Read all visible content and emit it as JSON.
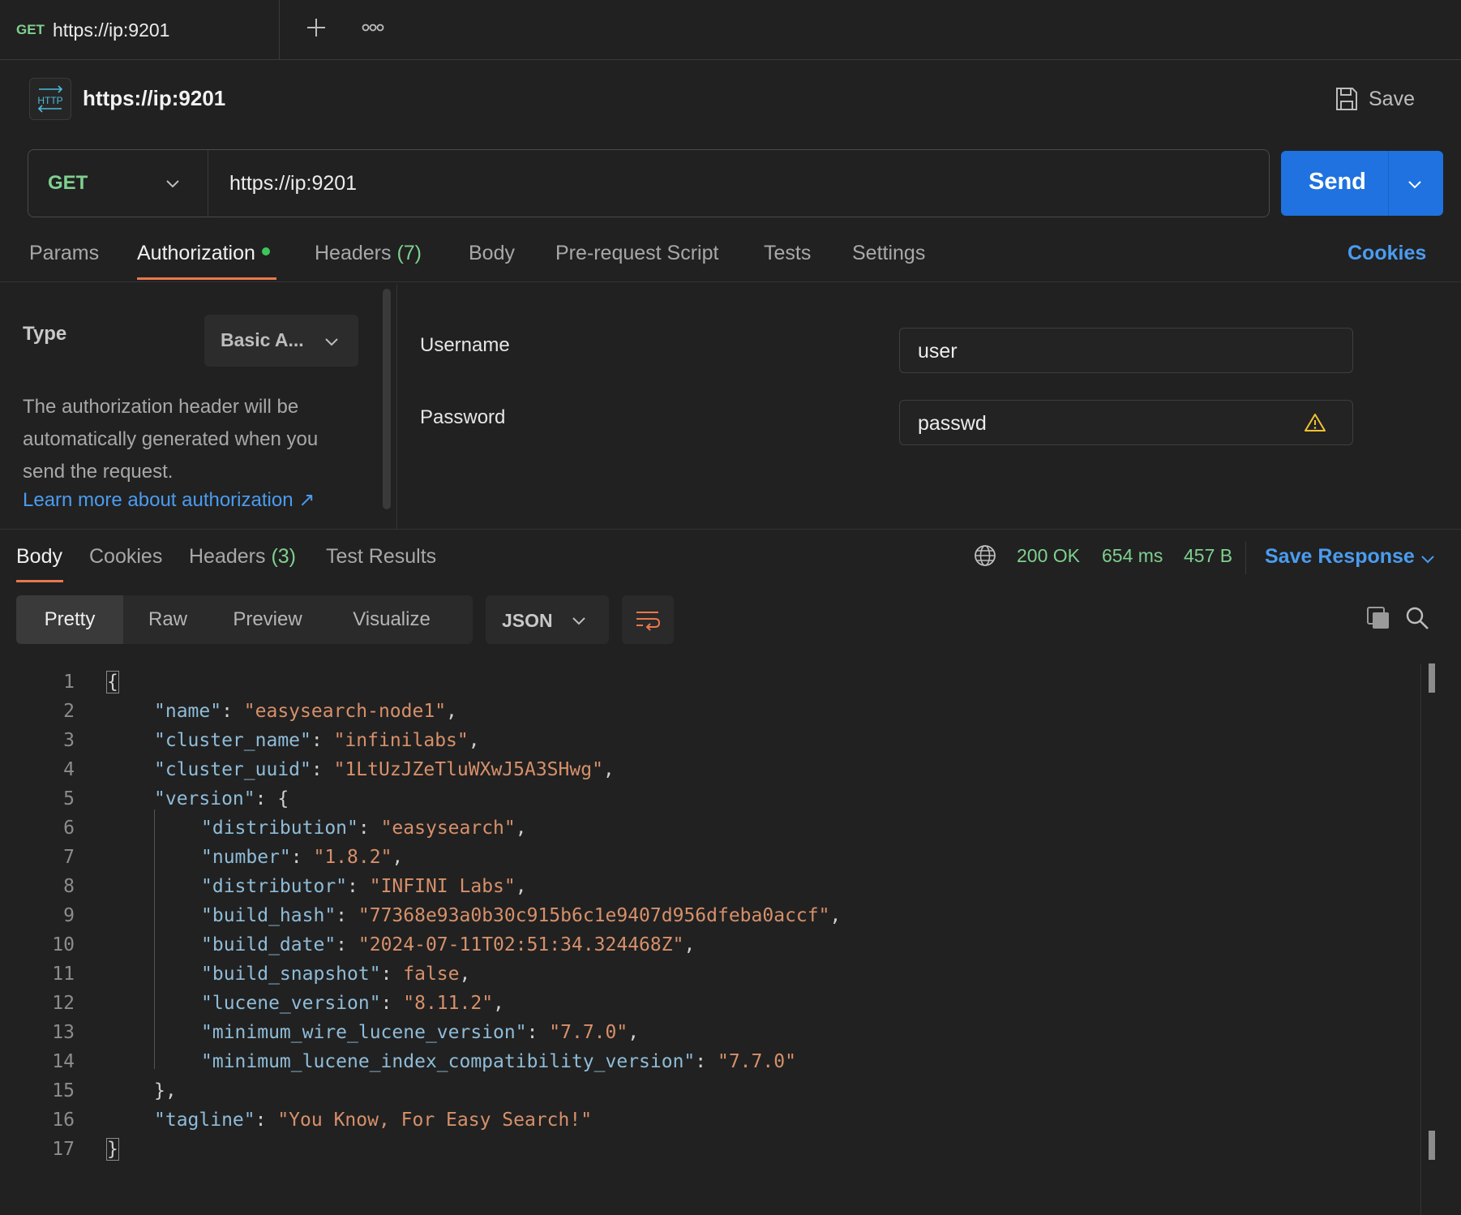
{
  "tab": {
    "method": "GET",
    "title": "https://ip:9201"
  },
  "request": {
    "badge": "HTTP",
    "title": "https://ip:9201",
    "save_label": "Save",
    "method": "GET",
    "url": "https://ip:9201",
    "send_label": "Send"
  },
  "req_tabs": {
    "params": "Params",
    "authorization": "Authorization",
    "headers": "Headers",
    "headers_count": "(7)",
    "body": "Body",
    "prerequest": "Pre-request Script",
    "tests": "Tests",
    "settings": "Settings",
    "cookies": "Cookies"
  },
  "auth": {
    "type_label": "Type",
    "type_value": "Basic A...",
    "description": "The authorization header will be automatically generated when you send the request.",
    "learn_more": "Learn more about authorization ↗",
    "username_label": "Username",
    "username_value": "user",
    "password_label": "Password",
    "password_value": "passwd"
  },
  "response": {
    "tabs": {
      "body": "Body",
      "cookies": "Cookies",
      "headers": "Headers",
      "headers_count": "(3)",
      "test_results": "Test Results"
    },
    "status": "200 OK",
    "time": "654 ms",
    "size": "457 B",
    "save_response": "Save Response",
    "views": [
      "Pretty",
      "Raw",
      "Preview",
      "Visualize"
    ],
    "format": "JSON"
  },
  "colors": {
    "accent_blue": "#1f72e0",
    "link_blue": "#4a9cf0",
    "method_green": "#7fd08f",
    "tab_underline": "#e8784c",
    "json_key": "#8fbcd8",
    "json_string": "#d7906a"
  },
  "icons": [
    "http-icon",
    "plus-icon",
    "more-icon",
    "save-icon",
    "chevron-down-icon",
    "warning-icon",
    "globe-icon",
    "wrap-icon",
    "copy-icon",
    "search-icon"
  ],
  "code_lines": [
    {
      "n": "1",
      "indent": 0,
      "key": "",
      "val": "",
      "raw": "{",
      "type": "open"
    },
    {
      "n": "2",
      "indent": 1,
      "key": "\"name\"",
      "val": "\"easysearch-node1\"",
      "tail": ","
    },
    {
      "n": "3",
      "indent": 1,
      "key": "\"cluster_name\"",
      "val": "\"infinilabs\"",
      "tail": ","
    },
    {
      "n": "4",
      "indent": 1,
      "key": "\"cluster_uuid\"",
      "val": "\"1LtUzJZeTluWXwJ5A3SHwg\"",
      "tail": ","
    },
    {
      "n": "5",
      "indent": 1,
      "key": "\"version\"",
      "val": "",
      "tail": "{",
      "type": "objopen"
    },
    {
      "n": "6",
      "indent": 2,
      "key": "\"distribution\"",
      "val": "\"easysearch\"",
      "tail": ","
    },
    {
      "n": "7",
      "indent": 2,
      "key": "\"number\"",
      "val": "\"1.8.2\"",
      "tail": ","
    },
    {
      "n": "8",
      "indent": 2,
      "key": "\"distributor\"",
      "val": "\"INFINI Labs\"",
      "tail": ","
    },
    {
      "n": "9",
      "indent": 2,
      "key": "\"build_hash\"",
      "val": "\"77368e93a0b30c915b6c1e9407d956dfeba0accf\"",
      "tail": ","
    },
    {
      "n": "10",
      "indent": 2,
      "key": "\"build_date\"",
      "val": "\"2024-07-11T02:51:34.324468Z\"",
      "tail": ","
    },
    {
      "n": "11",
      "indent": 2,
      "key": "\"build_snapshot\"",
      "val": "false",
      "tail": ","
    },
    {
      "n": "12",
      "indent": 2,
      "key": "\"lucene_version\"",
      "val": "\"8.11.2\"",
      "tail": ","
    },
    {
      "n": "13",
      "indent": 2,
      "key": "\"minimum_wire_lucene_version\"",
      "val": "\"7.7.0\"",
      "tail": ","
    },
    {
      "n": "14",
      "indent": 2,
      "key": "\"minimum_lucene_index_compatibility_version\"",
      "val": "\"7.7.0\"",
      "tail": ""
    },
    {
      "n": "15",
      "indent": 1,
      "key": "",
      "val": "",
      "raw": "},",
      "type": "close"
    },
    {
      "n": "16",
      "indent": 1,
      "key": "\"tagline\"",
      "val": "\"You Know, For Easy Search!\"",
      "tail": ""
    },
    {
      "n": "17",
      "indent": 0,
      "key": "",
      "val": "",
      "raw": "}",
      "type": "close"
    }
  ]
}
